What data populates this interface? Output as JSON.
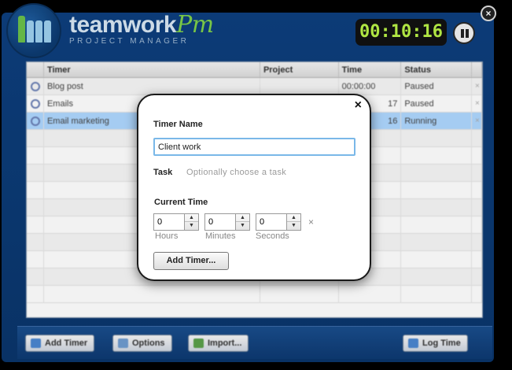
{
  "header": {
    "brand_name": "teamwork",
    "brand_pm": "Pm",
    "brand_sub": "PROJECT MANAGER",
    "clock": "00:10:16"
  },
  "table": {
    "columns": [
      "Timer",
      "Project",
      "Time",
      "Status"
    ],
    "rows": [
      {
        "timer": "Blog post",
        "project": "",
        "time": "00:00:00",
        "status": "Paused",
        "x": "×"
      },
      {
        "timer": "Emails",
        "project": "",
        "time": "17",
        "status": "Paused",
        "x": "×"
      },
      {
        "timer": "Email marketing",
        "project": "",
        "time": "16",
        "status": "Running",
        "x": "×"
      }
    ]
  },
  "toolbar": {
    "add_timer": "Add Timer",
    "options": "Options",
    "import": "Import...",
    "log_time": "Log Time"
  },
  "modal": {
    "close": "×",
    "timer_name_label": "Timer Name",
    "timer_name_value": "Client work",
    "task_label": "Task",
    "task_hint": "Optionally choose a task",
    "current_time_label": "Current Time",
    "hours_value": "0",
    "minutes_value": "0",
    "seconds_value": "0",
    "hours_label": "Hours",
    "minutes_label": "Minutes",
    "seconds_label": "Seconds",
    "clear": "×",
    "add_button": "Add Timer..."
  },
  "colors": {
    "frame": "#0d3f7e",
    "clock_text": "#b9f247",
    "active_row": "#aed7ff",
    "brand_accent": "#7fd04a"
  }
}
